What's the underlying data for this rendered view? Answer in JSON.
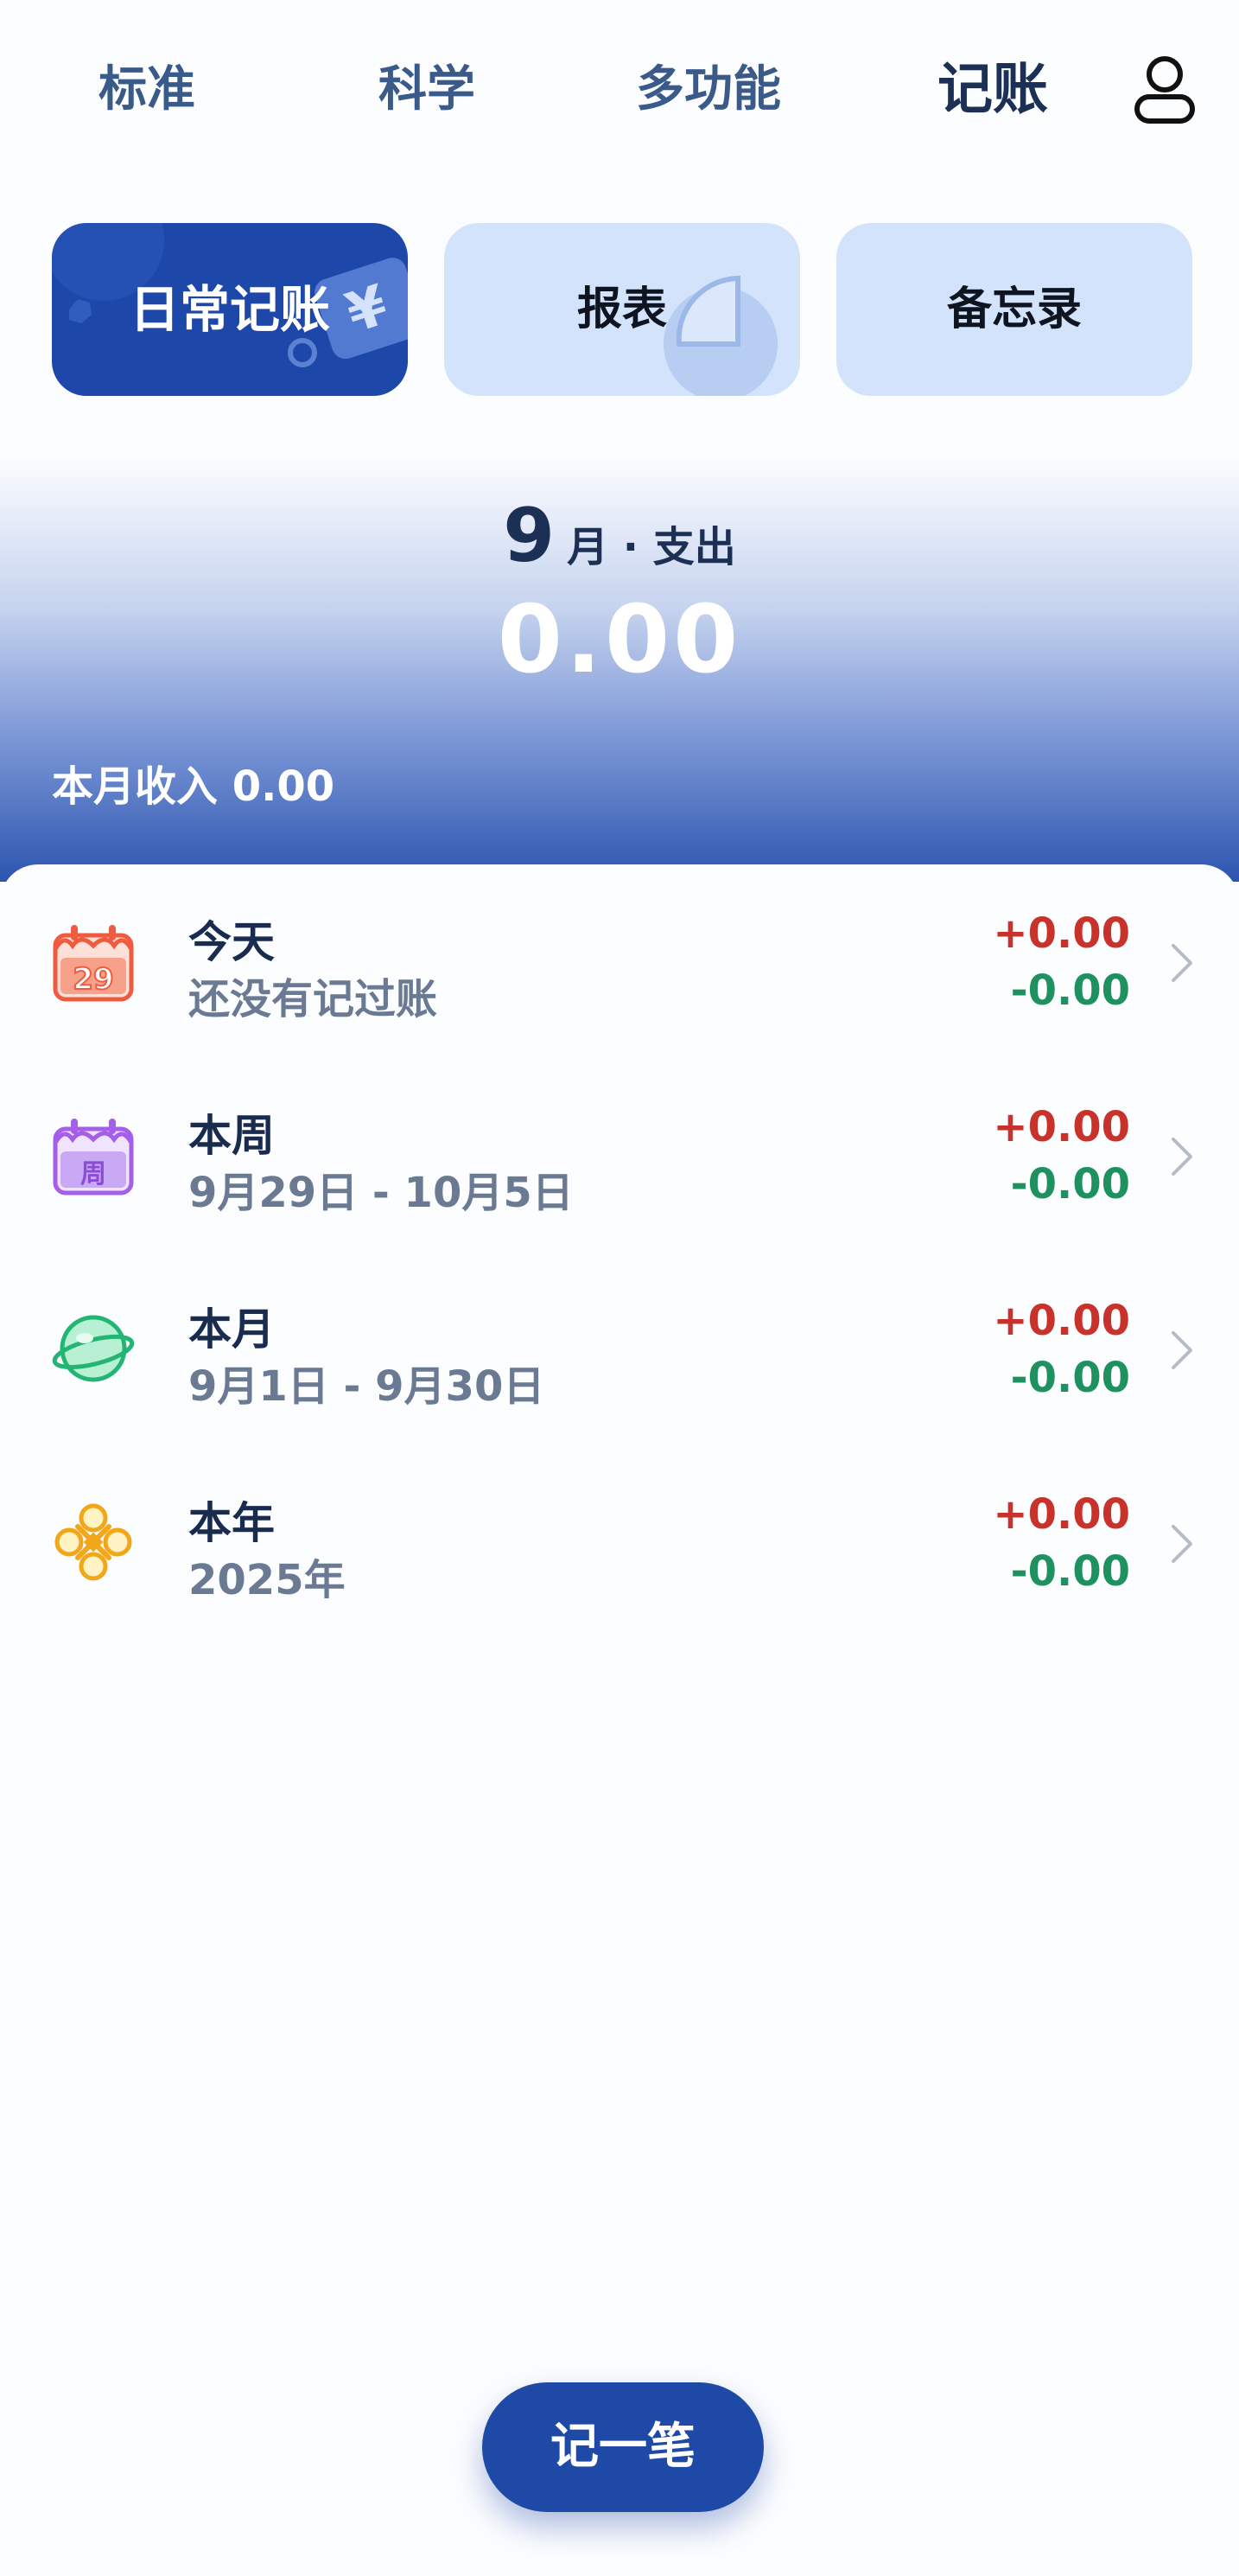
{
  "nav": {
    "tabs": [
      {
        "label": "标准",
        "active": false
      },
      {
        "label": "科学",
        "active": false
      },
      {
        "label": "多功能",
        "active": false
      },
      {
        "label": "记账",
        "active": true
      }
    ],
    "user_icon": "user-icon"
  },
  "mode_cards": [
    {
      "label": "日常记账",
      "selected": true,
      "icon": "yen-tag-icon"
    },
    {
      "label": "报表",
      "selected": false,
      "icon": "pie-chart-icon"
    },
    {
      "label": "备忘录",
      "selected": false,
      "icon": ""
    }
  ],
  "summary": {
    "month": "9",
    "month_text": "月 · 支出",
    "amount": "0.00",
    "income_label": "本月收入 0.00"
  },
  "periods": [
    {
      "title": "今天",
      "subtitle": "还没有记过账",
      "income": "+0.00",
      "expense": "-0.00",
      "icon": "calendar-29-icon"
    },
    {
      "title": "本周",
      "subtitle": "9月29日 - 10月5日",
      "income": "+0.00",
      "expense": "-0.00",
      "icon": "calendar-week-icon"
    },
    {
      "title": "本月",
      "subtitle": "9月1日 - 9月30日",
      "income": "+0.00",
      "expense": "-0.00",
      "icon": "planet-icon"
    },
    {
      "title": "本年",
      "subtitle": "2025年",
      "income": "+0.00",
      "expense": "-0.00",
      "icon": "chinese-knot-icon"
    }
  ],
  "add_button": {
    "label": "记一笔"
  },
  "colors": {
    "accent": "#1d47a8",
    "income": "#c8322a",
    "expense": "#1f9160",
    "card_bg": "#d2e3fb"
  }
}
